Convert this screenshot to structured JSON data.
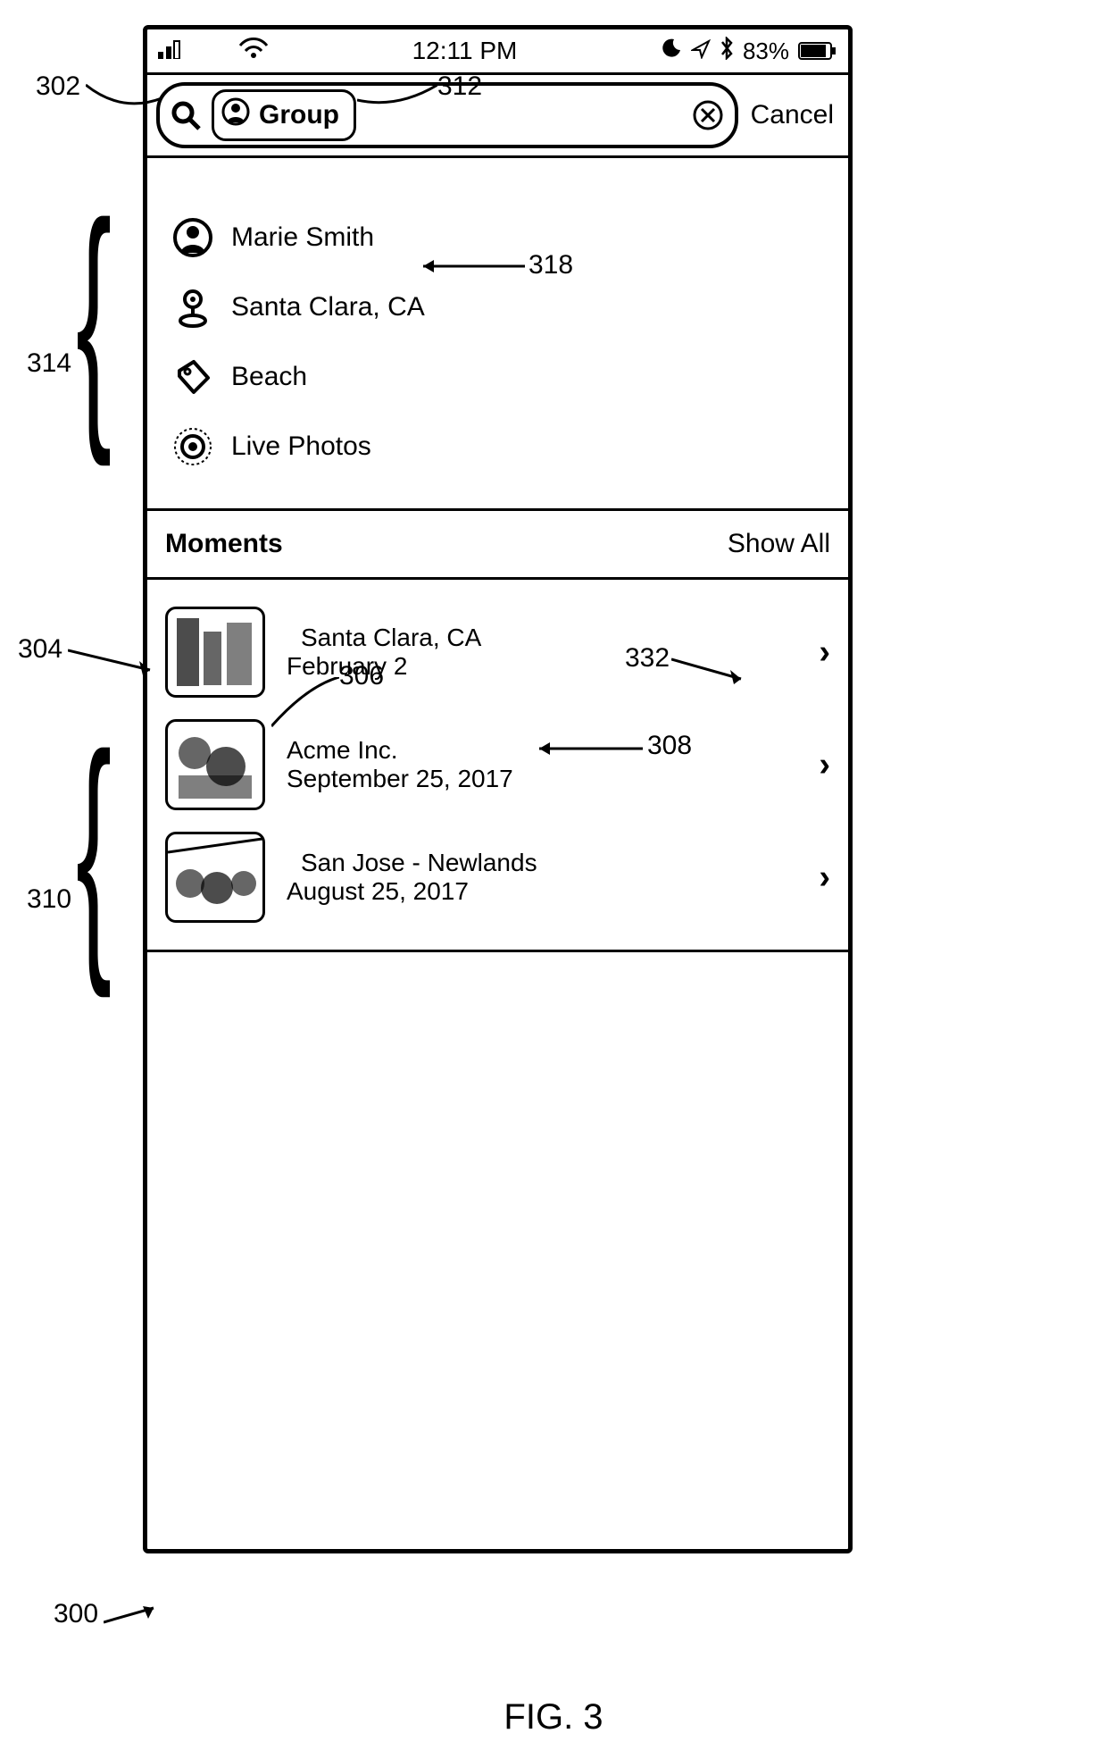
{
  "status": {
    "time": "12:11 PM",
    "battery": "83%"
  },
  "search": {
    "token": "Group",
    "cancel": "Cancel"
  },
  "suggestions": [
    {
      "label": "Marie Smith",
      "icon": "person-icon"
    },
    {
      "label": "Santa Clara, CA",
      "icon": "location-icon"
    },
    {
      "label": "Beach",
      "icon": "tag-icon"
    },
    {
      "label": "Live Photos",
      "icon": "livephotos-icon"
    }
  ],
  "section": {
    "title": "Moments",
    "showall": "Show All"
  },
  "results": [
    {
      "title": "Santa Clara, CA",
      "date": "February 2"
    },
    {
      "title": "Acme Inc.",
      "date": "September 25, 2017"
    },
    {
      "title": "San Jose - Newlands",
      "date": "August 25, 2017"
    }
  ],
  "refs": {
    "r300": "300",
    "r302": "302",
    "r304": "304",
    "r306": "306",
    "r308": "308",
    "r310": "310",
    "r312": "312",
    "r314": "314",
    "r318": "318",
    "r332": "332"
  },
  "figure": "FIG. 3"
}
